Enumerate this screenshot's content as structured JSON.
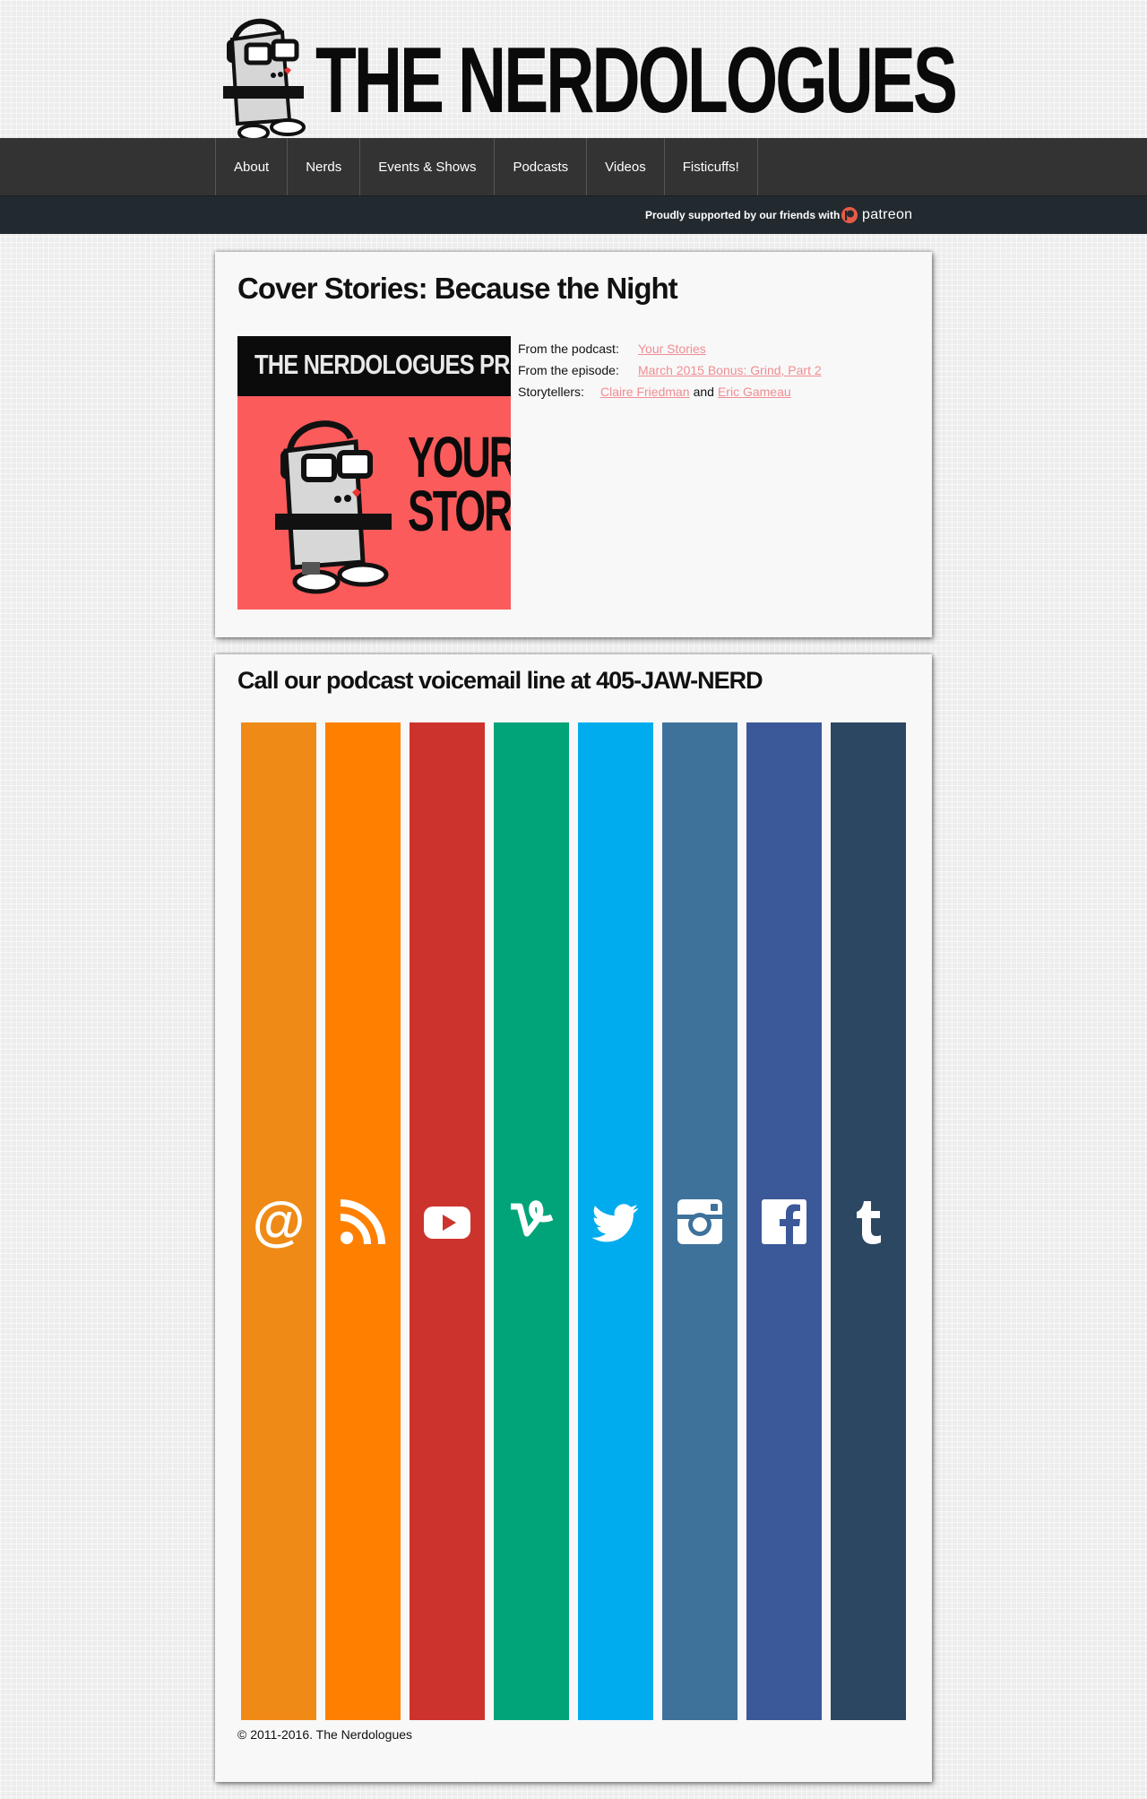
{
  "site": {
    "title": "THE NERDOLOGUES"
  },
  "nav": {
    "items": [
      "About",
      "Nerds",
      "Events & Shows",
      "Podcasts",
      "Videos",
      "Fisticuffs!"
    ]
  },
  "support": {
    "text": "Proudly supported by our friends with",
    "patreon_label": "patreon"
  },
  "post": {
    "title": "Cover Stories: Because the Night",
    "cover": {
      "band_text": "THE NERDOLOGUES PRESENTS",
      "line1": "YOUR",
      "line2": "STORIES"
    },
    "from_podcast_label": "From the podcast:",
    "podcast": "Your Stories",
    "from_episode_label": "From the episode:",
    "episode": "March 2015 Bonus: Grind, Part 2",
    "storytellers_label": "Storytellers:",
    "storyteller1": "Claire Friedman",
    "and": "and",
    "storyteller2": "Eric Gameau"
  },
  "voicemail": {
    "title": "Call our podcast voicemail line at 405-JAW-NERD"
  },
  "social": [
    {
      "icon": "at-icon",
      "color": "#ef8a17"
    },
    {
      "icon": "rss-icon",
      "color": "#ff8000"
    },
    {
      "icon": "youtube-icon",
      "color": "#cd332d"
    },
    {
      "icon": "vine-icon",
      "color": "#00a478"
    },
    {
      "icon": "twitter-icon",
      "color": "#00aced"
    },
    {
      "icon": "instagram-icon",
      "color": "#3f729b"
    },
    {
      "icon": "facebook-icon",
      "color": "#3b5998"
    },
    {
      "icon": "tumblr-icon",
      "color": "#2c4762"
    }
  ],
  "footer": {
    "copyright": "© 2011-2016. The Nerdologues"
  }
}
